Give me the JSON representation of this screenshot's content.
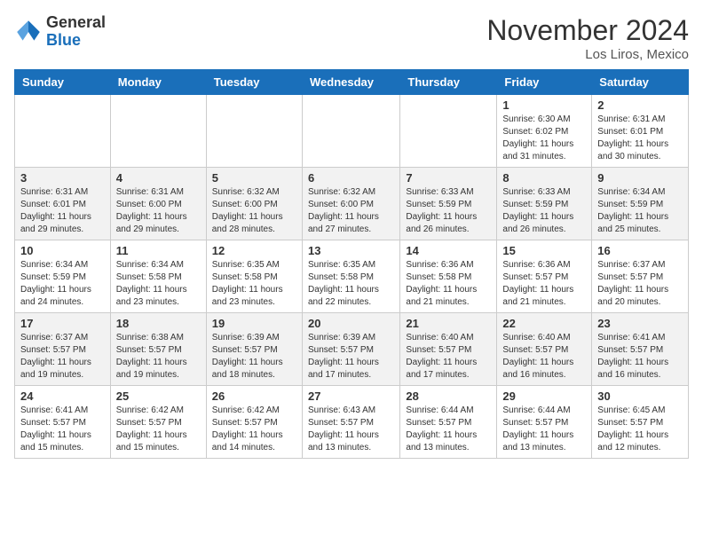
{
  "logo": {
    "general": "General",
    "blue": "Blue"
  },
  "title": "November 2024",
  "location": "Los Liros, Mexico",
  "weekdays": [
    "Sunday",
    "Monday",
    "Tuesday",
    "Wednesday",
    "Thursday",
    "Friday",
    "Saturday"
  ],
  "weeks": [
    [
      {
        "day": "",
        "info": ""
      },
      {
        "day": "",
        "info": ""
      },
      {
        "day": "",
        "info": ""
      },
      {
        "day": "",
        "info": ""
      },
      {
        "day": "",
        "info": ""
      },
      {
        "day": "1",
        "info": "Sunrise: 6:30 AM\nSunset: 6:02 PM\nDaylight: 11 hours\nand 31 minutes."
      },
      {
        "day": "2",
        "info": "Sunrise: 6:31 AM\nSunset: 6:01 PM\nDaylight: 11 hours\nand 30 minutes."
      }
    ],
    [
      {
        "day": "3",
        "info": "Sunrise: 6:31 AM\nSunset: 6:01 PM\nDaylight: 11 hours\nand 29 minutes."
      },
      {
        "day": "4",
        "info": "Sunrise: 6:31 AM\nSunset: 6:00 PM\nDaylight: 11 hours\nand 29 minutes."
      },
      {
        "day": "5",
        "info": "Sunrise: 6:32 AM\nSunset: 6:00 PM\nDaylight: 11 hours\nand 28 minutes."
      },
      {
        "day": "6",
        "info": "Sunrise: 6:32 AM\nSunset: 6:00 PM\nDaylight: 11 hours\nand 27 minutes."
      },
      {
        "day": "7",
        "info": "Sunrise: 6:33 AM\nSunset: 5:59 PM\nDaylight: 11 hours\nand 26 minutes."
      },
      {
        "day": "8",
        "info": "Sunrise: 6:33 AM\nSunset: 5:59 PM\nDaylight: 11 hours\nand 26 minutes."
      },
      {
        "day": "9",
        "info": "Sunrise: 6:34 AM\nSunset: 5:59 PM\nDaylight: 11 hours\nand 25 minutes."
      }
    ],
    [
      {
        "day": "10",
        "info": "Sunrise: 6:34 AM\nSunset: 5:59 PM\nDaylight: 11 hours\nand 24 minutes."
      },
      {
        "day": "11",
        "info": "Sunrise: 6:34 AM\nSunset: 5:58 PM\nDaylight: 11 hours\nand 23 minutes."
      },
      {
        "day": "12",
        "info": "Sunrise: 6:35 AM\nSunset: 5:58 PM\nDaylight: 11 hours\nand 23 minutes."
      },
      {
        "day": "13",
        "info": "Sunrise: 6:35 AM\nSunset: 5:58 PM\nDaylight: 11 hours\nand 22 minutes."
      },
      {
        "day": "14",
        "info": "Sunrise: 6:36 AM\nSunset: 5:58 PM\nDaylight: 11 hours\nand 21 minutes."
      },
      {
        "day": "15",
        "info": "Sunrise: 6:36 AM\nSunset: 5:57 PM\nDaylight: 11 hours\nand 21 minutes."
      },
      {
        "day": "16",
        "info": "Sunrise: 6:37 AM\nSunset: 5:57 PM\nDaylight: 11 hours\nand 20 minutes."
      }
    ],
    [
      {
        "day": "17",
        "info": "Sunrise: 6:37 AM\nSunset: 5:57 PM\nDaylight: 11 hours\nand 19 minutes."
      },
      {
        "day": "18",
        "info": "Sunrise: 6:38 AM\nSunset: 5:57 PM\nDaylight: 11 hours\nand 19 minutes."
      },
      {
        "day": "19",
        "info": "Sunrise: 6:39 AM\nSunset: 5:57 PM\nDaylight: 11 hours\nand 18 minutes."
      },
      {
        "day": "20",
        "info": "Sunrise: 6:39 AM\nSunset: 5:57 PM\nDaylight: 11 hours\nand 17 minutes."
      },
      {
        "day": "21",
        "info": "Sunrise: 6:40 AM\nSunset: 5:57 PM\nDaylight: 11 hours\nand 17 minutes."
      },
      {
        "day": "22",
        "info": "Sunrise: 6:40 AM\nSunset: 5:57 PM\nDaylight: 11 hours\nand 16 minutes."
      },
      {
        "day": "23",
        "info": "Sunrise: 6:41 AM\nSunset: 5:57 PM\nDaylight: 11 hours\nand 16 minutes."
      }
    ],
    [
      {
        "day": "24",
        "info": "Sunrise: 6:41 AM\nSunset: 5:57 PM\nDaylight: 11 hours\nand 15 minutes."
      },
      {
        "day": "25",
        "info": "Sunrise: 6:42 AM\nSunset: 5:57 PM\nDaylight: 11 hours\nand 15 minutes."
      },
      {
        "day": "26",
        "info": "Sunrise: 6:42 AM\nSunset: 5:57 PM\nDaylight: 11 hours\nand 14 minutes."
      },
      {
        "day": "27",
        "info": "Sunrise: 6:43 AM\nSunset: 5:57 PM\nDaylight: 11 hours\nand 13 minutes."
      },
      {
        "day": "28",
        "info": "Sunrise: 6:44 AM\nSunset: 5:57 PM\nDaylight: 11 hours\nand 13 minutes."
      },
      {
        "day": "29",
        "info": "Sunrise: 6:44 AM\nSunset: 5:57 PM\nDaylight: 11 hours\nand 13 minutes."
      },
      {
        "day": "30",
        "info": "Sunrise: 6:45 AM\nSunset: 5:57 PM\nDaylight: 11 hours\nand 12 minutes."
      }
    ]
  ]
}
